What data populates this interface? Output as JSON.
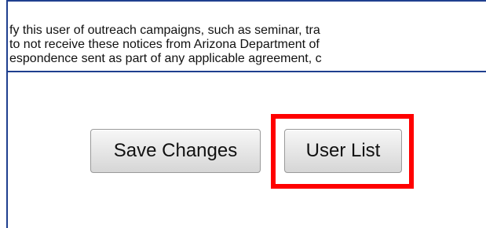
{
  "notice": {
    "lines": [
      "fy this user of outreach campaigns, such as seminar, tra",
      " to not receive these notices from Arizona Department of",
      "espondence sent as part of any applicable agreement, c"
    ]
  },
  "actions": {
    "save_label": "Save Changes",
    "user_list_label": "User List"
  },
  "colors": {
    "frame_border": "#1f3f8f",
    "highlight": "#ff0000"
  }
}
